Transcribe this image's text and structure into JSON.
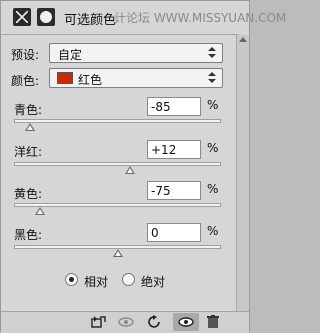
{
  "title": "可选颜色",
  "watermark": "计论坛  WWW.MISSYUAN.COM",
  "preset": {
    "label": "预设:",
    "value": "自定"
  },
  "color": {
    "label": "颜色:",
    "value": "红色",
    "swatch": "#cc2a00"
  },
  "sliders": [
    {
      "label": "青色:",
      "value": "-85",
      "unit": "%",
      "level": -85
    },
    {
      "label": "洋红:",
      "value": "+12",
      "unit": "%",
      "level": 12
    },
    {
      "label": "黄色:",
      "value": "-75",
      "unit": "%",
      "level": -75
    },
    {
      "label": "黑色:",
      "value": "0",
      "unit": "%",
      "level": 0
    }
  ],
  "method": {
    "relative": "相对",
    "absolute": "绝对",
    "selected": "relative"
  },
  "bottom_icons": [
    "clip-to-layer-icon",
    "eye-preview-icon",
    "reset-icon",
    "visibility-icon",
    "delete-icon"
  ]
}
